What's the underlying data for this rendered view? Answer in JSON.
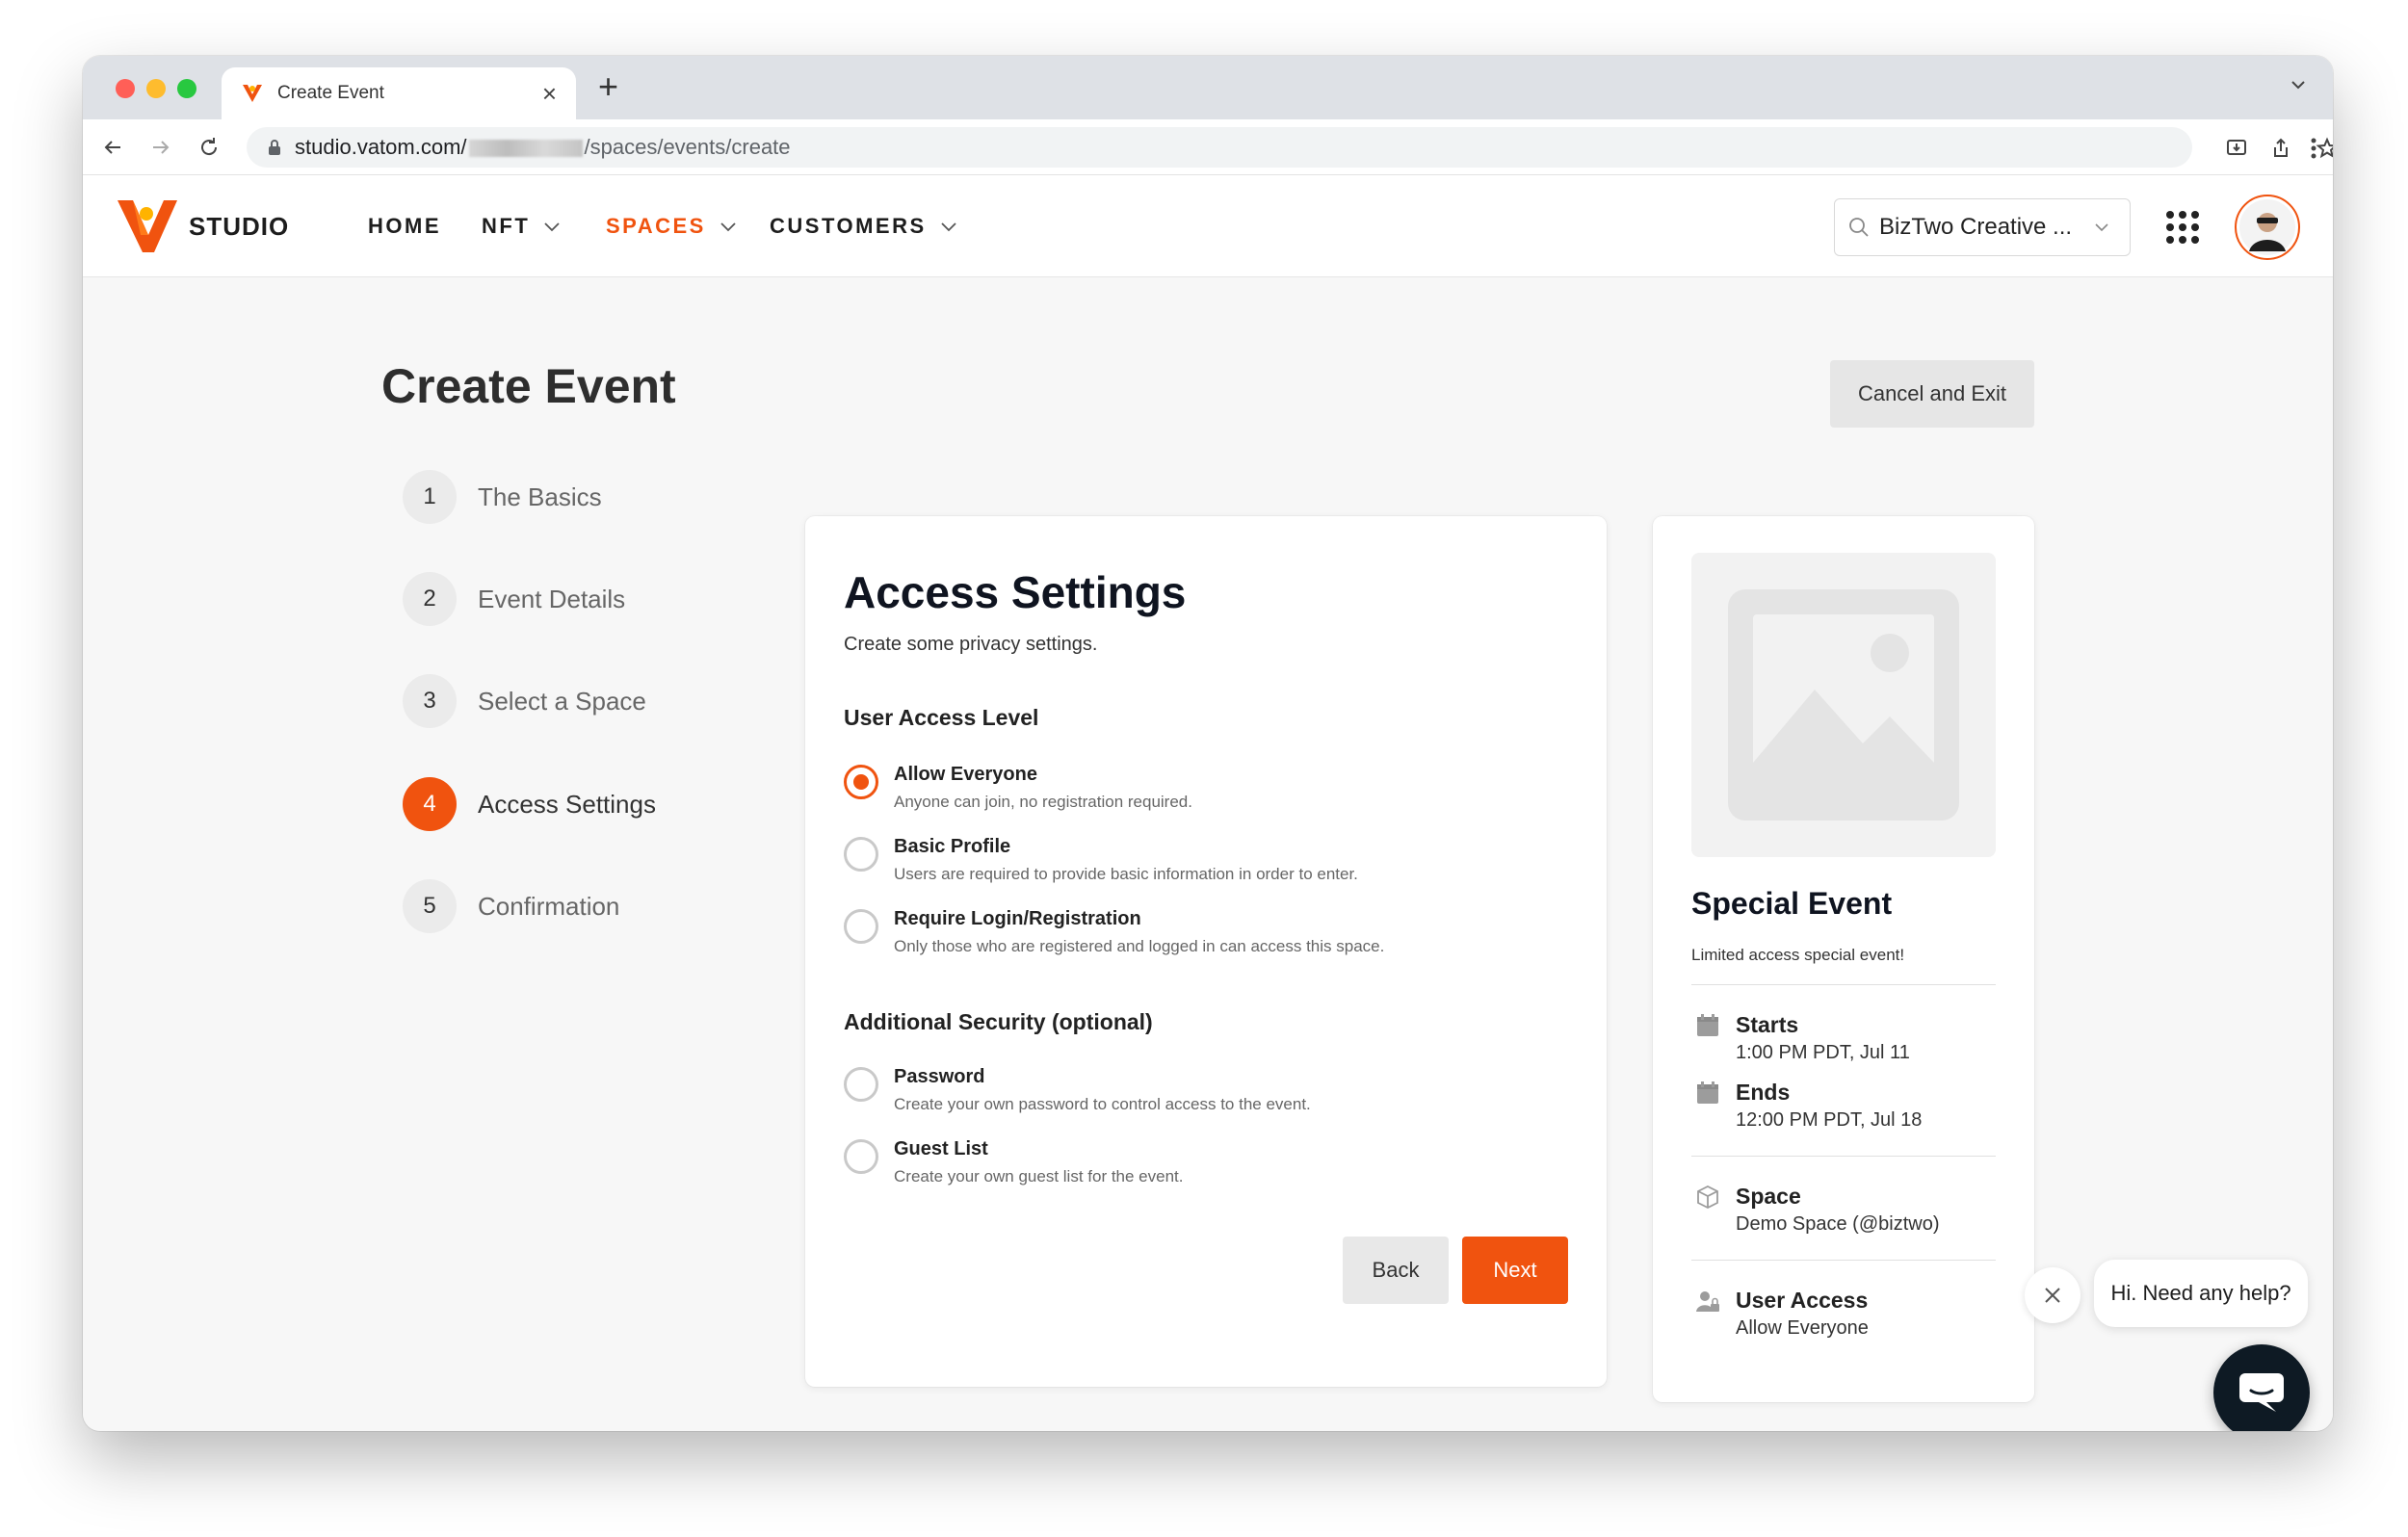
{
  "browser": {
    "tab_title": "Create Event",
    "new_tab": "+",
    "tab_close": "×",
    "url_prefix": "studio.vatom.com/",
    "url_suffix": "/spaces/events/create"
  },
  "header": {
    "logo_text": "STUDIO",
    "nav": [
      {
        "label": "HOME",
        "active": false,
        "dropdown": false
      },
      {
        "label": "NFT",
        "active": false,
        "dropdown": true
      },
      {
        "label": "SPACES",
        "active": true,
        "dropdown": true
      },
      {
        "label": "CUSTOMERS",
        "active": false,
        "dropdown": true
      }
    ],
    "org_selector": "BizTwo Creative ...",
    "apps_icon": "grid-icon",
    "avatar_icon": "user-avatar"
  },
  "page": {
    "title": "Create Event",
    "cancel_label": "Cancel and Exit"
  },
  "steps": [
    {
      "num": "1",
      "label": "The Basics",
      "active": false
    },
    {
      "num": "2",
      "label": "Event Details",
      "active": false
    },
    {
      "num": "3",
      "label": "Select a Space",
      "active": false
    },
    {
      "num": "4",
      "label": "Access Settings",
      "active": true
    },
    {
      "num": "5",
      "label": "Confirmation",
      "active": false
    }
  ],
  "form": {
    "title": "Access Settings",
    "subtitle": "Create some privacy settings.",
    "access_heading": "User Access Level",
    "access_options": [
      {
        "title": "Allow Everyone",
        "desc": "Anyone can join, no registration required.",
        "checked": true
      },
      {
        "title": "Basic Profile",
        "desc": "Users are required to provide basic information in order to enter.",
        "checked": false
      },
      {
        "title": "Require Login/Registration",
        "desc": "Only those who are registered and logged in can access this space.",
        "checked": false
      }
    ],
    "security_heading": "Additional Security (optional)",
    "security_options": [
      {
        "title": "Password",
        "desc": "Create your own password to control access to the event.",
        "checked": false
      },
      {
        "title": "Guest List",
        "desc": "Create your own guest list for the event.",
        "checked": false
      }
    ],
    "back_label": "Back",
    "next_label": "Next"
  },
  "preview": {
    "title": "Special Event",
    "description": "Limited access special event!",
    "starts_label": "Starts",
    "starts_value": "1:00 PM PDT, Jul 11",
    "ends_label": "Ends",
    "ends_value": "12:00 PM PDT, Jul 18",
    "space_label": "Space",
    "space_value": "Demo Space (@biztwo)",
    "access_label": "User Access",
    "access_value": "Allow Everyone"
  },
  "help": {
    "bubble_text": "Hi. Need any help?"
  },
  "colors": {
    "accent": "#f0530f",
    "launcher": "#0e1a24",
    "page_bg": "#f7f7f7"
  }
}
